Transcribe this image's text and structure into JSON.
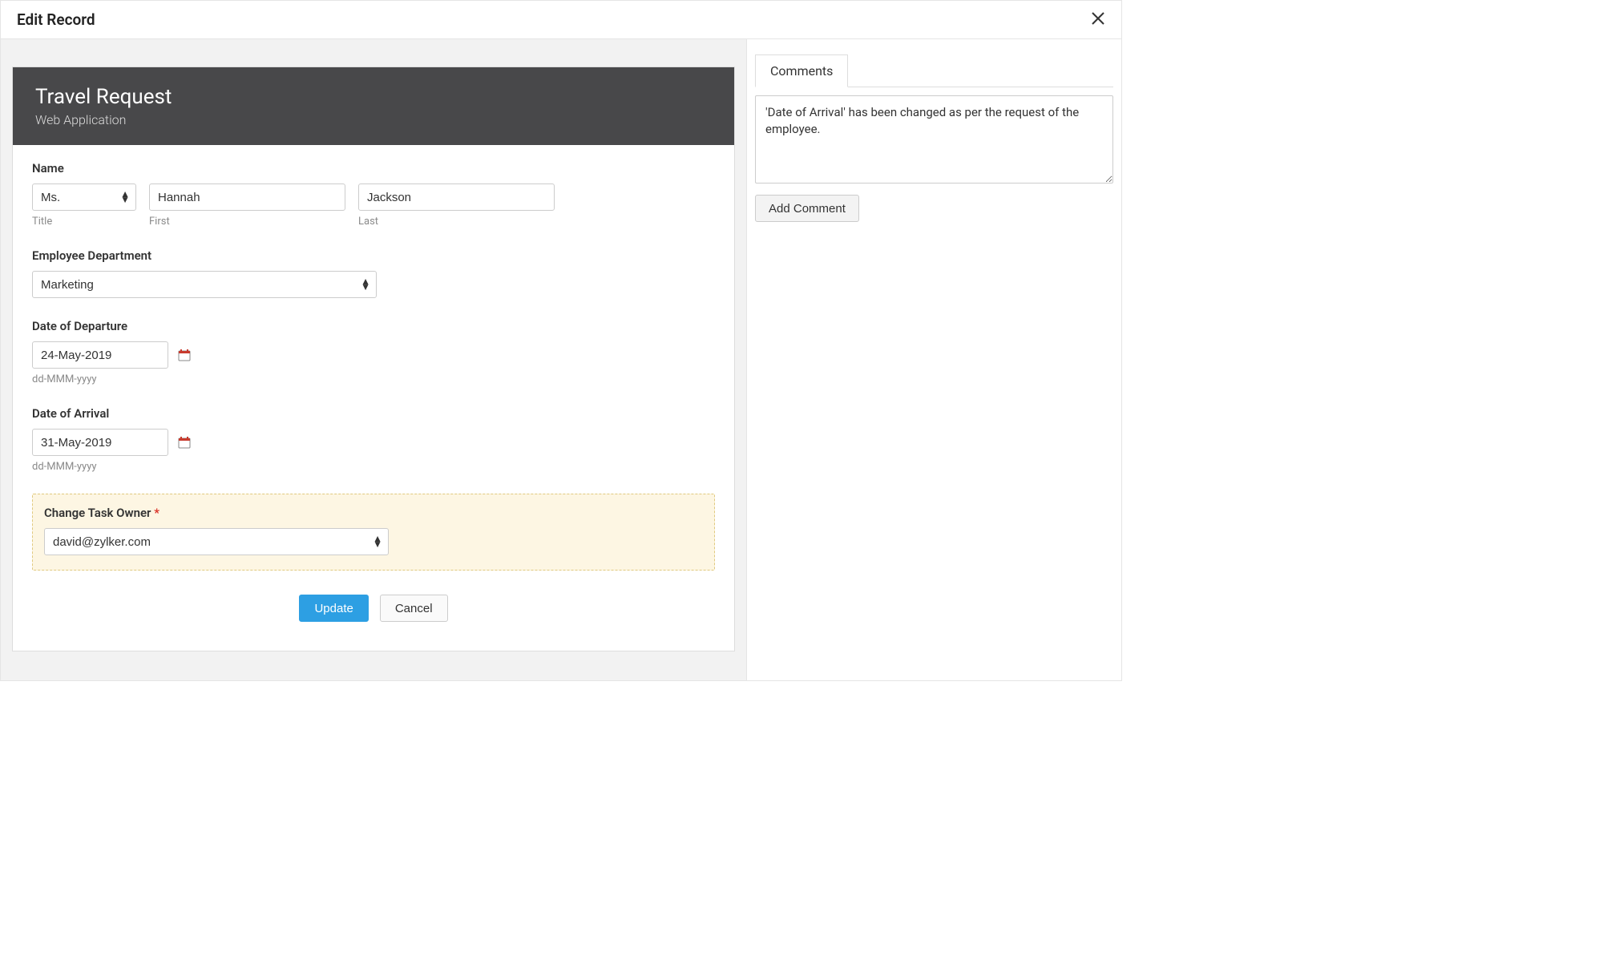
{
  "modal": {
    "title": "Edit Record"
  },
  "form": {
    "title": "Travel Request",
    "subtitle": "Web Application",
    "name": {
      "label": "Name",
      "title_value": "Ms.",
      "title_helper": "Title",
      "first_value": "Hannah",
      "first_helper": "First",
      "last_value": "Jackson",
      "last_helper": "Last"
    },
    "department": {
      "label": "Employee Department",
      "value": "Marketing"
    },
    "departure": {
      "label": "Date of Departure",
      "value": "24-May-2019",
      "format": "dd-MMM-yyyy"
    },
    "arrival": {
      "label": "Date of Arrival",
      "value": "31-May-2019",
      "format": "dd-MMM-yyyy"
    },
    "owner": {
      "label": "Change Task Owner",
      "value": "david@zylker.com"
    },
    "actions": {
      "update": "Update",
      "cancel": "Cancel"
    }
  },
  "comments": {
    "tab_label": "Comments",
    "text": "'Date of Arrival' has been changed as per the request of the employee.",
    "add_label": "Add Comment"
  }
}
